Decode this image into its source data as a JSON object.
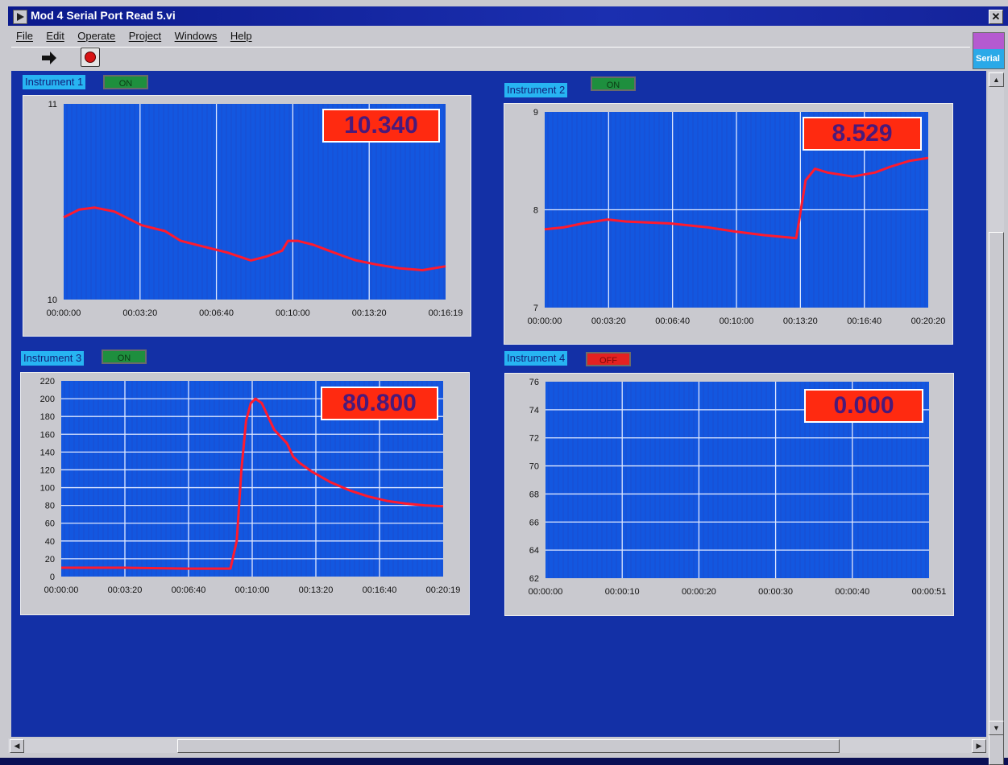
{
  "window": {
    "title": "Mod 4 Serial Port Read 5.vi",
    "close": "✕"
  },
  "menu": [
    "File",
    "Edit",
    "Operate",
    "Project",
    "Windows",
    "Help"
  ],
  "toolbar": {
    "run_icon": "run-arrow-icon",
    "stop_icon": "stop-icon"
  },
  "side_badge": {
    "label": "Serial"
  },
  "colors": {
    "panel": "#1330a6",
    "plot_bg": "#1357e0",
    "trace": "#ff1a2e",
    "indicator": "#ff2a10"
  },
  "instruments": [
    {
      "label": "Instrument 1",
      "switch": "ON",
      "value": "10.340"
    },
    {
      "label": "Instrument 2",
      "switch": "ON",
      "value": "8.529"
    },
    {
      "label": "Instrument 3",
      "switch": "ON",
      "value": "80.800"
    },
    {
      "label": "Instrument 4",
      "switch": "OFF",
      "value": "0.000"
    }
  ],
  "chart_data": [
    {
      "type": "line",
      "ylim": [
        10,
        11
      ],
      "yticks": [
        "11",
        "10"
      ],
      "xticks": [
        "00:00:00",
        "00:03:20",
        "00:06:40",
        "00:10:00",
        "00:13:20",
        "00:16:19"
      ],
      "xlim_seconds": [
        0,
        979
      ],
      "series": [
        {
          "x": [
            0,
            40,
            80,
            130,
            200,
            260,
            300,
            360,
            420,
            480,
            520,
            560,
            575,
            600,
            640,
            680,
            720,
            750,
            800,
            860,
            920,
            979
          ],
          "y": [
            10.42,
            10.46,
            10.47,
            10.45,
            10.38,
            10.35,
            10.3,
            10.27,
            10.24,
            10.2,
            10.22,
            10.25,
            10.3,
            10.3,
            10.28,
            10.25,
            10.22,
            10.2,
            10.18,
            10.16,
            10.15,
            10.17
          ]
        }
      ]
    },
    {
      "type": "line",
      "ylim": [
        7,
        9
      ],
      "yticks": [
        "9",
        "8",
        "7"
      ],
      "xticks": [
        "00:00:00",
        "00:03:20",
        "00:06:40",
        "00:10:00",
        "00:13:20",
        "00:16:40",
        "00:20:20"
      ],
      "xlim_seconds": [
        0,
        1220
      ],
      "series": [
        {
          "x": [
            0,
            60,
            120,
            200,
            260,
            400,
            520,
            600,
            700,
            800,
            810,
            830,
            860,
            900,
            980,
            1050,
            1100,
            1160,
            1220
          ],
          "y": [
            7.8,
            7.82,
            7.86,
            7.9,
            7.88,
            7.86,
            7.82,
            7.78,
            7.74,
            7.71,
            7.9,
            8.3,
            8.42,
            8.38,
            8.34,
            8.38,
            8.44,
            8.5,
            8.53
          ]
        }
      ]
    },
    {
      "type": "line",
      "ylim": [
        0,
        220
      ],
      "yticks": [
        "220",
        "200",
        "180",
        "160",
        "140",
        "120",
        "100",
        "80",
        "60",
        "40",
        "20",
        "0"
      ],
      "xticks": [
        "00:00:00",
        "00:03:20",
        "00:06:40",
        "00:10:00",
        "00:13:20",
        "00:16:40",
        "00:20:19"
      ],
      "xlim_seconds": [
        0,
        1219
      ],
      "series": [
        {
          "x": [
            0,
            200,
            400,
            540,
            560,
            575,
            590,
            605,
            620,
            640,
            660,
            680,
            720,
            740,
            760,
            800,
            860,
            920,
            980,
            1040,
            1100,
            1160,
            1219
          ],
          "y": [
            10,
            10,
            9,
            9,
            40,
            120,
            175,
            195,
            200,
            195,
            180,
            165,
            150,
            135,
            128,
            118,
            106,
            97,
            90,
            85,
            82,
            80,
            79
          ]
        }
      ]
    },
    {
      "type": "line",
      "ylim": [
        62,
        76
      ],
      "yticks": [
        "76",
        "74",
        "72",
        "70",
        "68",
        "66",
        "64",
        "62"
      ],
      "xticks": [
        "00:00:00",
        "00:00:10",
        "00:00:20",
        "00:00:30",
        "00:00:40",
        "00:00:51"
      ],
      "xlim_seconds": [
        0,
        51
      ],
      "series": []
    }
  ]
}
